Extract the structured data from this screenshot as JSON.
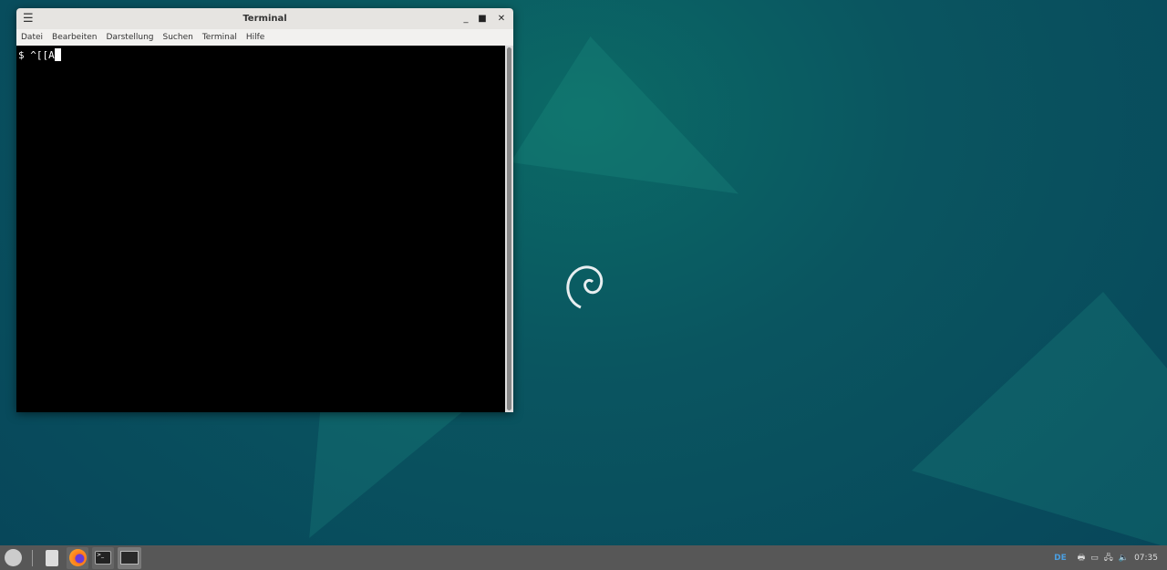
{
  "window": {
    "title": "Terminal",
    "menu": [
      "Datei",
      "Bearbeiten",
      "Darstellung",
      "Suchen",
      "Terminal",
      "Hilfe"
    ],
    "content": "$ ^[[A"
  },
  "panel": {
    "keyboard_layout": "DE",
    "clock": "07:35"
  },
  "colors": {
    "accent": "#4a9ee0",
    "panel": "#575757"
  }
}
